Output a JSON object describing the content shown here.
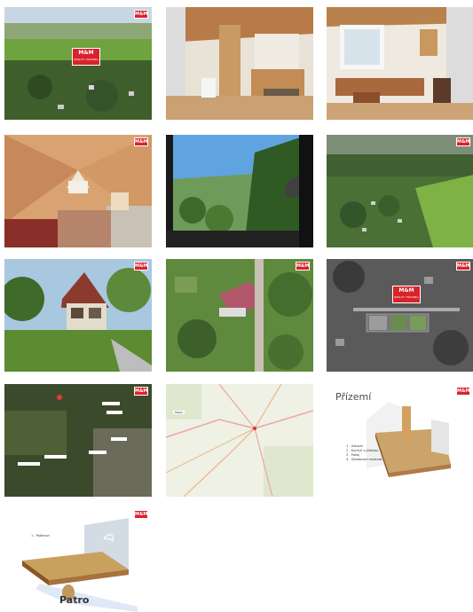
{
  "gallery": {
    "brand": "M&M",
    "brand_tagline": "REALITY HOLDING",
    "images": [
      {
        "id": "aerial-panorama",
        "alt": "aerial-photo"
      },
      {
        "id": "interior-ground-1",
        "alt": "interior-photo"
      },
      {
        "id": "interior-ground-2",
        "alt": "interior-photo"
      },
      {
        "id": "attic-room",
        "alt": "interior-photo"
      },
      {
        "id": "window-view",
        "alt": "view-photo"
      },
      {
        "id": "aerial-colony",
        "alt": "aerial-photo"
      },
      {
        "id": "cottage-exterior",
        "alt": "exterior-photo"
      },
      {
        "id": "cottage-aerial-close",
        "alt": "aerial-photo"
      },
      {
        "id": "cadastral-bw",
        "alt": "aerial-map"
      },
      {
        "id": "satellite-map",
        "alt": "map"
      },
      {
        "id": "road-map",
        "alt": "map"
      },
      {
        "id": "floorplan-ground",
        "alt": "floor-plan"
      },
      {
        "id": "floorplan-upper",
        "alt": "floor-plan"
      }
    ]
  },
  "floorplan_ground": {
    "title": "Přízemí",
    "legend": [
      "1 - Vstupní",
      "2 - Kuchyň s jídelnou",
      "3 - Pokoj",
      "4 - Skladovací místnost"
    ]
  },
  "floorplan_upper": {
    "title": "Patro",
    "legend": [
      "1 - Podkroví"
    ]
  },
  "road_map": {
    "town": "Město"
  }
}
